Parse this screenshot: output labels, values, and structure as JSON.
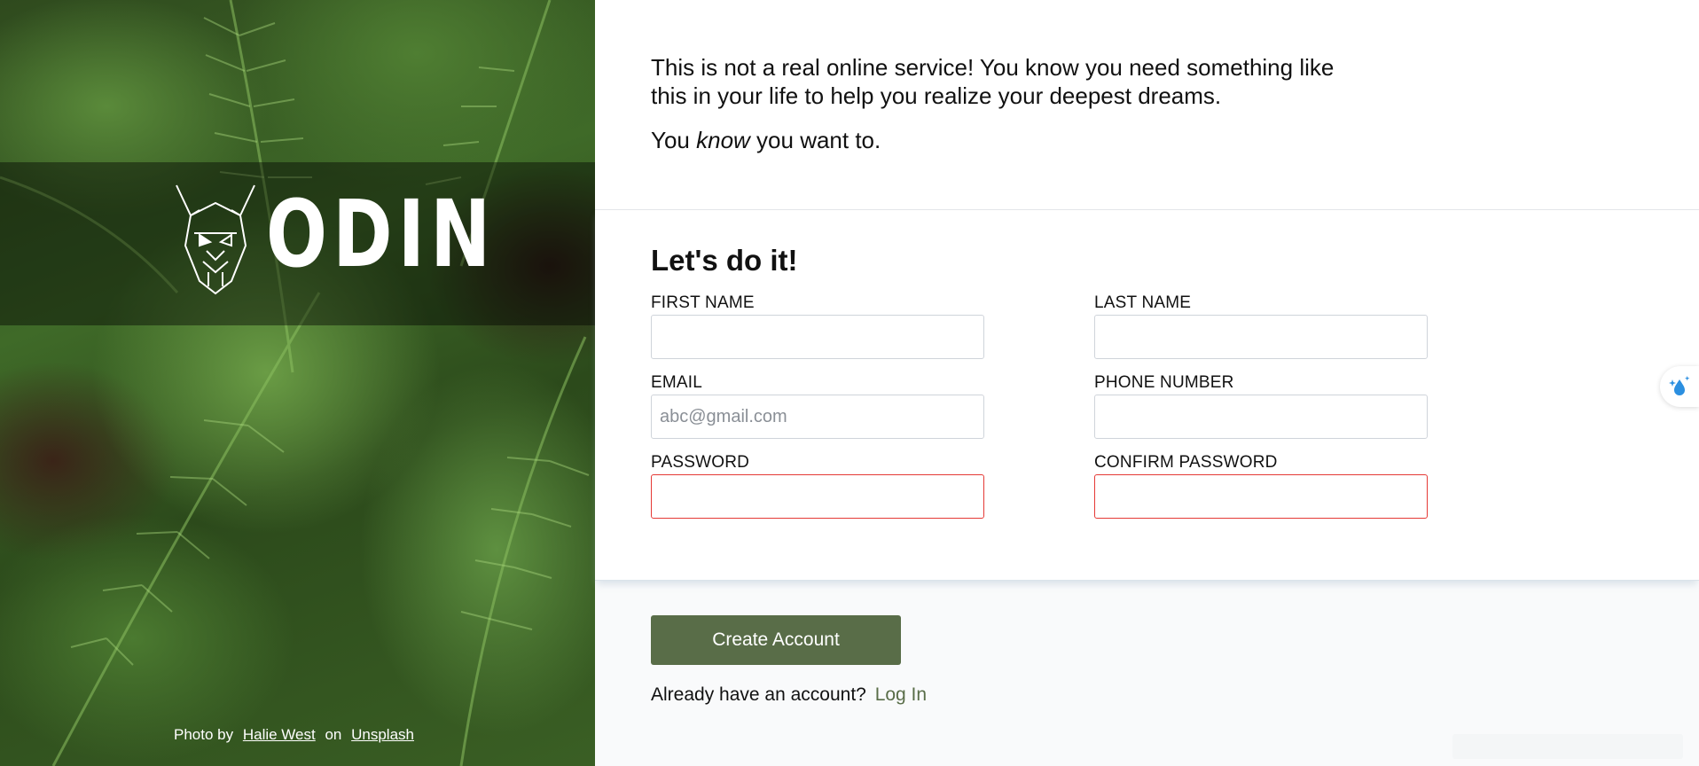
{
  "hero": {
    "logo_text": "ODIN",
    "credit": {
      "prefix": "Photo by",
      "author": "Halie West",
      "middle": "on",
      "source": "Unsplash"
    }
  },
  "intro": {
    "line1": "This is not a real online service! You know you need something like this in your life to help you realize your deepest dreams.",
    "line2_before": "You",
    "line2_em": "know",
    "line2_after": "you want to."
  },
  "form": {
    "heading": "Let's do it!",
    "first_name": {
      "label": "FIRST NAME",
      "value": "",
      "placeholder": ""
    },
    "last_name": {
      "label": "LAST NAME",
      "value": "",
      "placeholder": ""
    },
    "email": {
      "label": "EMAIL",
      "value": "",
      "placeholder": "abc@gmail.com"
    },
    "phone": {
      "label": "PHONE NUMBER",
      "value": "",
      "placeholder": ""
    },
    "password": {
      "label": "PASSWORD",
      "value": "",
      "placeholder": ""
    },
    "confirm_password": {
      "label": "CONFIRM PASSWORD",
      "value": "",
      "placeholder": ""
    }
  },
  "actions": {
    "create_label": "Create Account",
    "login_prompt": "Already have an account?",
    "login_link": "Log In"
  },
  "colors": {
    "accent": "#596d48",
    "error_border": "#e53935",
    "widget_icon": "#2b8fe0"
  },
  "icons": {
    "logo": "viking-helmet-icon",
    "side_widget": "sparkle-drop-icon"
  }
}
